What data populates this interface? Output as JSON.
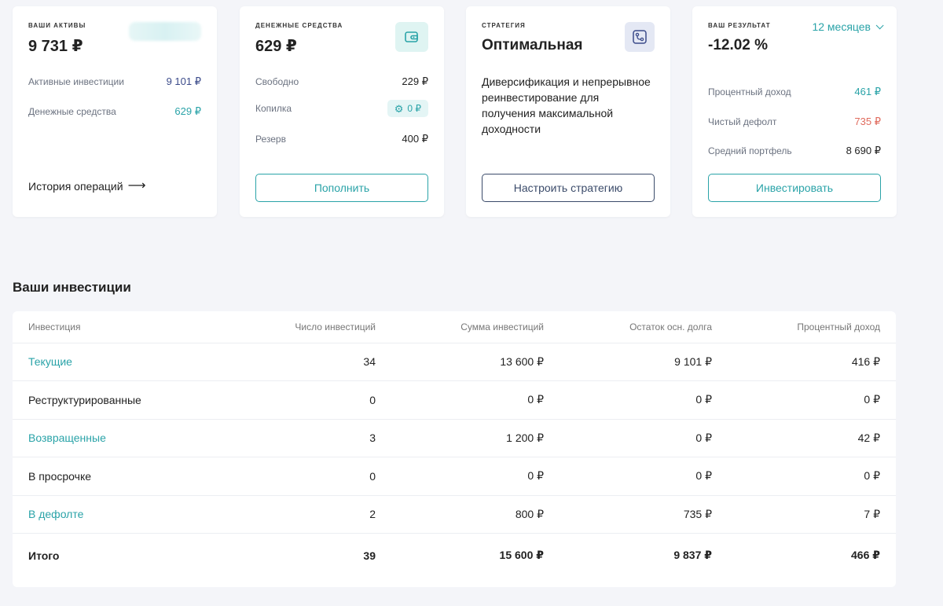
{
  "cards": {
    "assets": {
      "label": "ВАШИ АКТИВЫ",
      "value": "9 731 ₽",
      "rows": [
        {
          "label": "Активные инвестиции",
          "value": "9 101 ₽"
        },
        {
          "label": "Денежные средства",
          "value": "629 ₽"
        }
      ],
      "history_link": "История операций",
      "arrow_glyph": "⟶"
    },
    "cash": {
      "label": "ДЕНЕЖНЫЕ СРЕДСТВА",
      "value": "629 ₽",
      "icon": "wallet-icon",
      "rows": [
        {
          "label": "Свободно",
          "value": "229 ₽"
        },
        {
          "label": "Копилка",
          "value": "0 ₽"
        },
        {
          "label": "Резерв",
          "value": "400 ₽"
        }
      ],
      "button": "Пополнить"
    },
    "strategy": {
      "label": "СТРАТЕГИЯ",
      "name": "Оптимальная",
      "icon": "strategy-icon",
      "description": "Диверсификация и непрерывное реинвестирование для получения максимальной доходности",
      "button": "Настроить стратегию"
    },
    "result": {
      "label": "ВАШ РЕЗУЛЬТАТ",
      "period": "12 месяцев",
      "value": "-12.02 %",
      "rows": [
        {
          "label": "Процентный доход",
          "value": "461 ₽"
        },
        {
          "label": "Чистый дефолт",
          "value": "735 ₽"
        },
        {
          "label": "Средний портфель",
          "value": "8 690 ₽"
        }
      ],
      "button": "Инвестировать"
    }
  },
  "investments": {
    "title": "Ваши инвестиции",
    "headers": [
      "Инвестиция",
      "Число инвестиций",
      "Сумма инвестиций",
      "Остаток осн. долга",
      "Процентный доход"
    ],
    "rows": [
      {
        "name": "Текущие",
        "count": "34",
        "sum": "13 600  ₽",
        "remaining": "9 101  ₽",
        "income": "416  ₽",
        "link": true
      },
      {
        "name": "Реструктурированные",
        "count": "0",
        "sum": "0  ₽",
        "remaining": "0  ₽",
        "income": "0  ₽",
        "link": false
      },
      {
        "name": "Возвращенные",
        "count": "3",
        "sum": "1 200  ₽",
        "remaining": "0  ₽",
        "income": "42  ₽",
        "link": true
      },
      {
        "name": "В просрочке",
        "count": "0",
        "sum": "0  ₽",
        "remaining": "0  ₽",
        "income": "0  ₽",
        "link": false
      },
      {
        "name": "В дефолте",
        "count": "2",
        "sum": "800  ₽",
        "remaining": "735  ₽",
        "income": "7  ₽",
        "link": true
      }
    ],
    "total": {
      "name": "Итого",
      "count": "39",
      "sum": "15 600  ₽",
      "remaining": "9 837  ₽",
      "income": "466  ₽"
    }
  },
  "colors": {
    "accent": "#2aa3a8",
    "indigo": "#3b4b8a",
    "danger": "#e06b5d",
    "background": "#f4f5f9"
  }
}
